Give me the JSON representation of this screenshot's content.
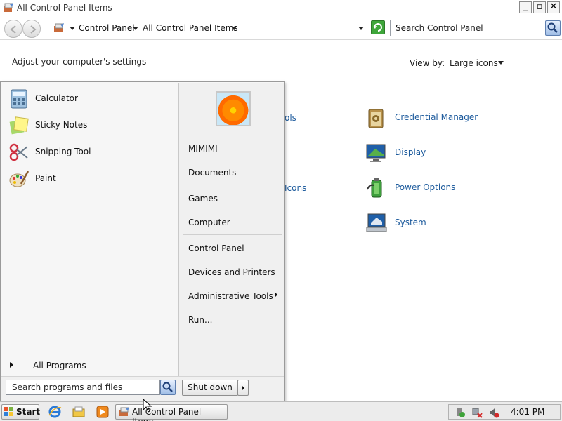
{
  "window": {
    "title": "All Control Panel Items",
    "minimize": "_",
    "maximize": "▫",
    "close": "✕"
  },
  "address": {
    "crumbs": [
      "Control Panel",
      "All Control Panel Items"
    ],
    "search_placeholder": "Search Control Panel"
  },
  "content": {
    "heading": "Adjust your computer's settings",
    "view_by_label": "View by:",
    "view_by_value": "Large icons",
    "partial_labels": [
      "ols",
      "Icons"
    ],
    "items": [
      {
        "label": "Credential Manager",
        "icon": "credential-manager-icon"
      },
      {
        "label": "Display",
        "icon": "display-icon"
      },
      {
        "label": "Power Options",
        "icon": "power-options-icon"
      },
      {
        "label": "System",
        "icon": "system-icon"
      }
    ]
  },
  "start_menu": {
    "programs": [
      {
        "label": "Calculator",
        "icon": "calculator-icon"
      },
      {
        "label": "Sticky Notes",
        "icon": "sticky-notes-icon"
      },
      {
        "label": "Snipping Tool",
        "icon": "snipping-tool-icon"
      },
      {
        "label": "Paint",
        "icon": "paint-icon"
      }
    ],
    "all_programs": "All Programs",
    "search_placeholder": "Search programs and files",
    "right_links": {
      "user": "MIMIMI",
      "documents": "Documents",
      "games": "Games",
      "computer": "Computer",
      "control_panel": "Control Panel",
      "devices": "Devices and Printers",
      "admin_tools": "Administrative Tools",
      "run": "Run..."
    },
    "shutdown": "Shut down"
  },
  "taskbar": {
    "start": "Start",
    "task_title": "All Control Panel Items",
    "clock": "4:01 PM"
  }
}
